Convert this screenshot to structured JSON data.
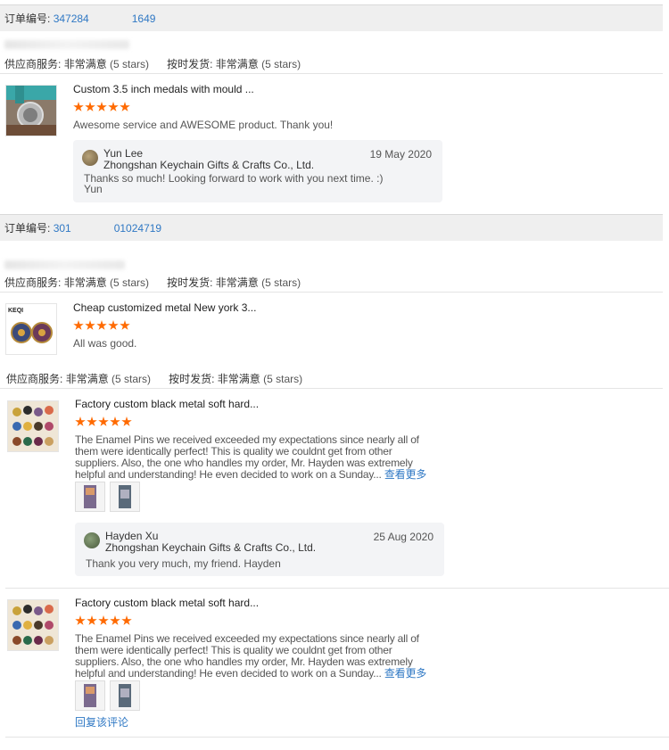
{
  "orders": [
    {
      "order_label": "订单编号:",
      "order_number": "347284    1649",
      "ratings": {
        "supplier_label": "供应商服务:",
        "supplier_value": "非常满意",
        "supplier_stars": "(5 stars)",
        "ontime_label": "按时发货:",
        "ontime_value": "非常满意",
        "ontime_stars": "(5 stars)"
      },
      "item": {
        "title": "Custom 3.5 inch medals with mould ...",
        "rating": 5,
        "review": "Awesome service and AWESOME product.  Thank you!",
        "reply": {
          "name": "Yun Lee",
          "company": "Zhongshan Keychain Gifts & Crafts Co., Ltd.",
          "date": "19 May 2020",
          "message_line1": "Thanks so much! Looking forward to work with you next time. :)",
          "message_line2": "Yun"
        }
      }
    },
    {
      "order_label": "订单编号:",
      "order_number": "301    01024719",
      "ratings": {
        "supplier_label": "供应商服务:",
        "supplier_value": "非常满意",
        "supplier_stars": "(5 stars)",
        "ontime_label": "按时发货:",
        "ontime_value": "非常满意",
        "ontime_stars": "(5 stars)"
      },
      "item1": {
        "title": "Cheap customized metal New york 3...",
        "rating": 5,
        "review": "All was good.",
        "thumb_text": "KEQI"
      },
      "ratings2": {
        "supplier_label": "供应商服务:",
        "supplier_value": "非常满意",
        "supplier_stars": "(5 stars)",
        "ontime_label": "按时发货:",
        "ontime_value": "非常满意",
        "ontime_stars": "(5 stars)"
      },
      "item2": {
        "title": "Factory custom black metal soft hard...",
        "rating": 5,
        "review": "The Enamel Pins we received exceeded my expectations since nearly all of them were identically perfect! This is quality we couldnt get from other suppliers. Also, the one who handles my order, Mr. Hayden was extremely helpful and understanding! He even decided to work on a Sunday...",
        "more": "查看更多",
        "reply": {
          "name": "Hayden Xu",
          "company": "Zhongshan Keychain Gifts & Crafts Co., Ltd.",
          "date": "25 Aug 2020",
          "message_line1": "Thank you very much, my friend. Hayden"
        }
      },
      "item3": {
        "title": "Factory custom black metal soft hard...",
        "rating": 5,
        "review": "The Enamel Pins we received exceeded my expectations since nearly all of them were identically perfect! This is quality we couldnt get from other suppliers. Also, the one who handles my order, Mr. Hayden was extremely helpful and understanding! He even decided to work on a Sunday...",
        "more": "查看更多",
        "reply_link": "回复该评论"
      }
    }
  ],
  "colors": {
    "accent": "#2f78c4",
    "star": "#ff6a00",
    "bar": "#efefef"
  }
}
